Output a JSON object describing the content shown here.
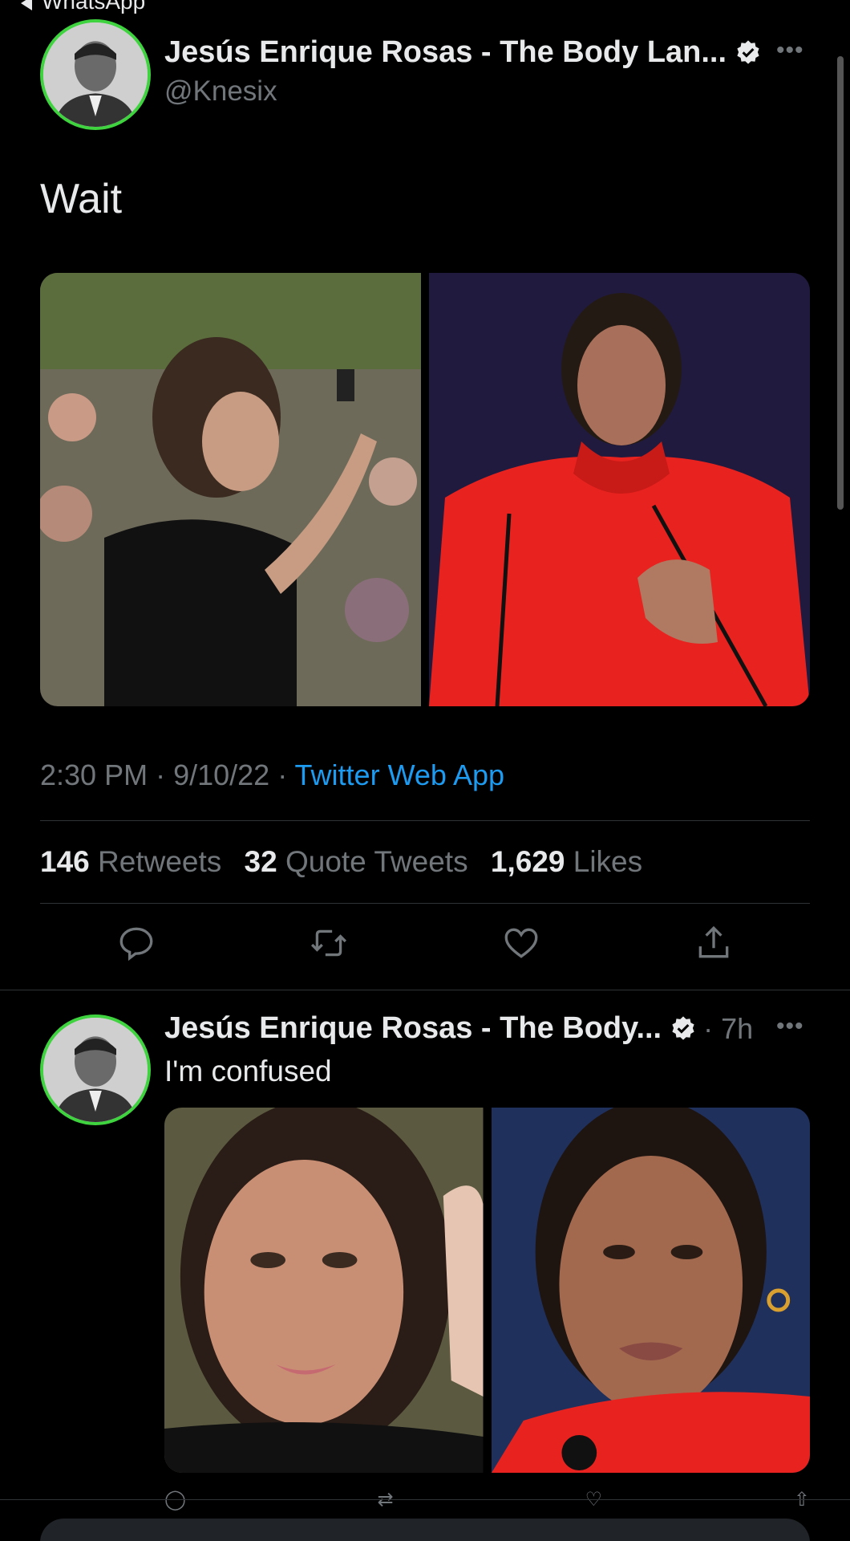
{
  "status": {
    "back_app": "WhatsApp"
  },
  "tweet": {
    "author_name": "Jesús Enrique Rosas - The Body Lan...",
    "handle": "@Knesix",
    "text": "Wait",
    "time": "2:30 PM",
    "date": "9/10/22",
    "source": "Twitter Web App",
    "stats": {
      "retweets_count": "146",
      "retweets_label": "Retweets",
      "quotes_count": "32",
      "quotes_label": "Quote Tweets",
      "likes_count": "1,629",
      "likes_label": "Likes"
    },
    "actions": [
      "reply-icon",
      "retweet-icon",
      "like-icon",
      "share-icon"
    ]
  },
  "reply": {
    "author_name": "Jesús Enrique Rosas - The Body...",
    "time": "· 7h",
    "text": "I'm confused"
  },
  "colors": {
    "background": "#000000",
    "link": "#1d9bf0",
    "muted": "#71767b",
    "avatar_ring": "#3fd33f",
    "red_dress": "#e8231f"
  }
}
